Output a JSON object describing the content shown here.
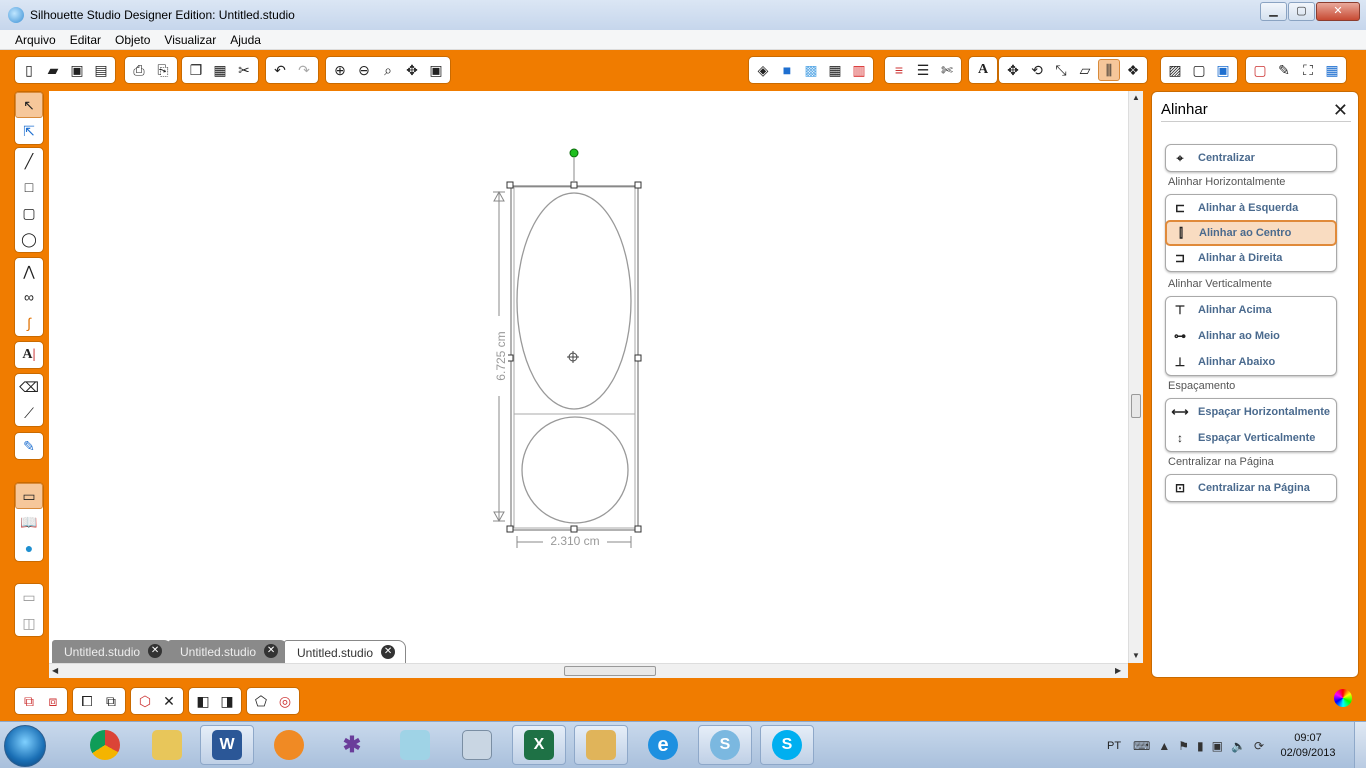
{
  "window": {
    "title": "Silhouette Studio Designer Edition: Untitled.studio",
    "minimize": "▁",
    "maximize": "▢",
    "close": "✕"
  },
  "menu": [
    "Arquivo",
    "Editar",
    "Objeto",
    "Visualizar",
    "Ajuda"
  ],
  "canvas": {
    "height_label": "6.725 cm",
    "width_label": "2.310 cm"
  },
  "tabs": [
    {
      "label": "Untitled.studio",
      "close": "✕"
    },
    {
      "label": "Untitled.studio",
      "close": "✕"
    },
    {
      "label": "Untitled.studio",
      "close": "✕"
    }
  ],
  "panel": {
    "title": "Alinhar",
    "close": "✕",
    "centralizar": "Centralizar",
    "section_horizontal": "Alinhar Horizontalmente",
    "align_left": "Alinhar à Esquerda",
    "align_center": "Alinhar ao Centro",
    "align_right": "Alinhar à Direita",
    "section_vertical": "Alinhar Verticalmente",
    "align_top": "Alinhar Acima",
    "align_middle": "Alinhar ao Meio",
    "align_bottom": "Alinhar Abaixo",
    "section_spacing": "Espaçamento",
    "space_h": "Espaçar Horizontalmente",
    "space_v": "Espaçar Verticalmente",
    "section_page": "Centralizar na Página",
    "center_page": "Centralizar na Página"
  },
  "taskbar": {
    "apps": [
      {
        "name": "chrome",
        "label": ""
      },
      {
        "name": "explorer",
        "label": ""
      },
      {
        "name": "word",
        "label": "W"
      },
      {
        "name": "media",
        "label": ""
      },
      {
        "name": "spider",
        "label": ""
      },
      {
        "name": "notepad",
        "label": ""
      },
      {
        "name": "calculator",
        "label": ""
      },
      {
        "name": "excel",
        "label": "X"
      },
      {
        "name": "folder",
        "label": ""
      },
      {
        "name": "ie",
        "label": "e"
      },
      {
        "name": "silhouette",
        "label": "S"
      },
      {
        "name": "skype",
        "label": "S"
      }
    ],
    "language": "PT",
    "time": "09:07",
    "date": "02/09/2013"
  },
  "colors": {
    "accent": "#f07c00",
    "selected_bg": "#f9dcc1",
    "panel_text": "#4a6a8e"
  }
}
